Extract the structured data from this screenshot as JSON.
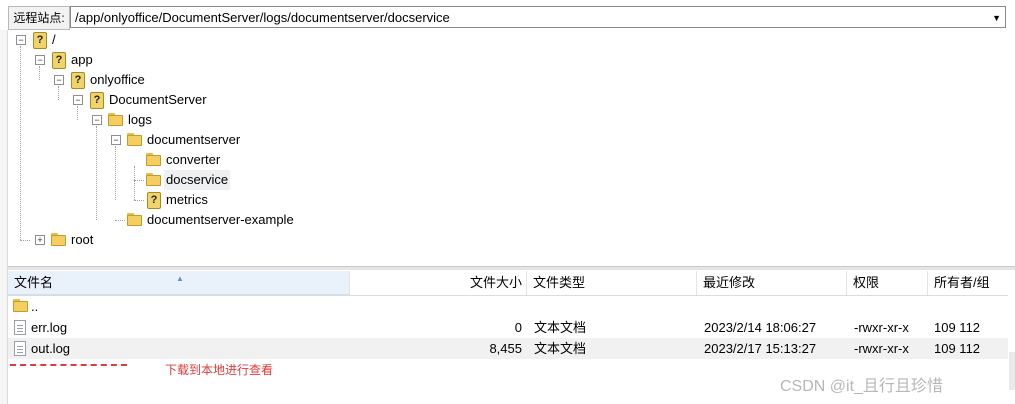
{
  "address_bar": {
    "label": "远程站点:",
    "path": "/app/onlyoffice/DocumentServer/logs/documentserver/docservice"
  },
  "tree": {
    "items": [
      {
        "label": "/",
        "icon": "question-icon",
        "expanded": true
      },
      {
        "label": "app",
        "icon": "question-icon",
        "expanded": true
      },
      {
        "label": "onlyoffice",
        "icon": "question-icon",
        "expanded": true
      },
      {
        "label": "DocumentServer",
        "icon": "question-icon",
        "expanded": true
      },
      {
        "label": "logs",
        "icon": "folder-icon",
        "expanded": true
      },
      {
        "label": "documentserver",
        "icon": "folder-icon",
        "expanded": true
      },
      {
        "label": "converter",
        "icon": "folder-icon"
      },
      {
        "label": "docservice",
        "icon": "folder-icon",
        "selected": true
      },
      {
        "label": "metrics",
        "icon": "question-icon"
      },
      {
        "label": "documentserver-example",
        "icon": "folder-icon"
      },
      {
        "label": "root",
        "icon": "folder-icon",
        "expanded": false
      }
    ]
  },
  "file_list": {
    "columns": [
      "文件名",
      "文件大小",
      "文件类型",
      "最近修改",
      "权限",
      "所有者/组"
    ],
    "rows": [
      {
        "name": "..",
        "size": "",
        "type": "",
        "modified": "",
        "perms": "",
        "owner": "",
        "icon": "folder-icon"
      },
      {
        "name": "err.log",
        "size": "0",
        "type": "文本文档",
        "modified": "2023/2/14 18:06:27",
        "perms": "-rwxr-xr-x",
        "owner": "109 112",
        "icon": "document-icon"
      },
      {
        "name": "out.log",
        "size": "8,455",
        "type": "文本文档",
        "modified": "2023/2/17 15:13:27",
        "perms": "-rwxr-xr-x",
        "owner": "109 112",
        "icon": "document-icon"
      }
    ]
  },
  "annotation": {
    "text": "下载到本地进行查看",
    "color": "#e03a3a"
  },
  "watermark": "CSDN @it_且行且珍惜"
}
